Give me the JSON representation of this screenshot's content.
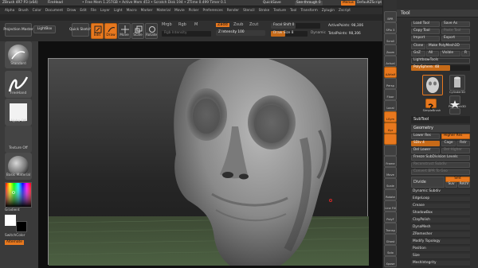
{
  "titlebar": {
    "app": "ZBrush 4R7 P3 (x64)",
    "doc": "FireHead",
    "free_mem": "• Free Mem 1.257GB • Active Mem 453 • Scratch Disk 194 • ZTime 0.499 Timer 0.1",
    "quicksave": "QuickSave",
    "seethrough": "See-through 0",
    "menus": "Menus",
    "script": "DefaultZScript"
  },
  "menubar": [
    "Alpha",
    "Brush",
    "Color",
    "Document",
    "Draw",
    "Edit",
    "File",
    "Layer",
    "Light",
    "Macro",
    "Marker",
    "Material",
    "Movie",
    "Picker",
    "Preferences",
    "Render",
    "Stencil",
    "Stroke",
    "Texture",
    "Tool",
    "Transform",
    "Zplugin",
    "Zscript"
  ],
  "shelf": {
    "projection_master": "Projection Master",
    "lightbox": "LightBox",
    "quick_sketch": "Quick Sketch",
    "tools": [
      {
        "label": "Edit",
        "active": true
      },
      {
        "label": "Draw",
        "active": true
      },
      {
        "label": "Move",
        "active": false
      },
      {
        "label": "Scale",
        "active": false
      },
      {
        "label": "Rotate",
        "active": false
      }
    ],
    "mrgb": "Mrgb",
    "rgb": "Rgb",
    "m": "M",
    "rgb_intensity": "Rgb Intensity",
    "zadd": "Zadd",
    "zsub": "Zsub",
    "zcut": "Zcut",
    "z_intensity": "Z Intensity 100",
    "focal_shift": "Focal Shift 0",
    "draw_size": "Draw Size 8",
    "dynamic": "Dynamic",
    "active_points": "ActivePoints: 98,306",
    "total_points": "TotalPoints: 98,306"
  },
  "leftpanel": {
    "items": [
      "Standard",
      "FreeHand",
      "Alpha Off",
      "Texture Off",
      "Basic Material"
    ],
    "gradient": "Gradient",
    "switch_color": "SwitchColor",
    "alternate": "Alternate"
  },
  "rtools": [
    "BPR",
    "SPix 3",
    "Scroll",
    "Zoom",
    "Actual",
    "AAHalf",
    "Persp",
    "Floor",
    "Local",
    "LSym",
    "Xyz",
    "",
    "",
    "Frame",
    "Move",
    "Scale",
    "Rotate",
    "Line Fill",
    "PolyF",
    "Transp",
    "Ghost",
    "Solo",
    "Xpose"
  ],
  "palette": {
    "title": "Tool",
    "load_tool": "Load Tool",
    "save_as": "Save As",
    "copy_tool": "Copy Tool",
    "paste_tool": "Paste Tool",
    "import": "Import",
    "export": "Export",
    "clone": "Clone",
    "make_polymesh": "Make PolyMesh3D",
    "goz": "GoZ",
    "all": "All",
    "visible": "Visible",
    "r": "R",
    "lightbox_tools": "Lightbox▸Tools",
    "current_tool": "PolySphere. 48",
    "thumbs": [
      "PolySphere",
      "Cylinder3D",
      "PolyMesh3D",
      "SimpleBrush",
      "PolySphere"
    ],
    "sections": [
      "SubTool",
      "Geometry"
    ],
    "lower_res": "Lower Res",
    "higher_res": "Higher Res",
    "sdiv": "SDiv 4",
    "cage": "Cage",
    "rstr": "Rstr",
    "del_lower": "Del Lower",
    "del_higher": "Del Higher",
    "freeze": "Freeze SubDivision Levels",
    "reconstruct": "Reconstruct Subdiv",
    "convert_bpr": "Convert BPR To Geo",
    "divide": "Divide",
    "smt": "Smt",
    "suv": "Suv",
    "reuv": "ReUV",
    "list": [
      "Dynamic Subdiv",
      "EdgeLoop",
      "Crease",
      "ShadowBox",
      "ClayPolish",
      "DynaMesh",
      "ZRemesher",
      "Modify Topology",
      "Position",
      "Size",
      "MeshIntegrity"
    ]
  },
  "colors": {
    "accent": "#e8781e",
    "panel": "#3a3a3a",
    "viewport_bg": "#0f0f0f"
  }
}
